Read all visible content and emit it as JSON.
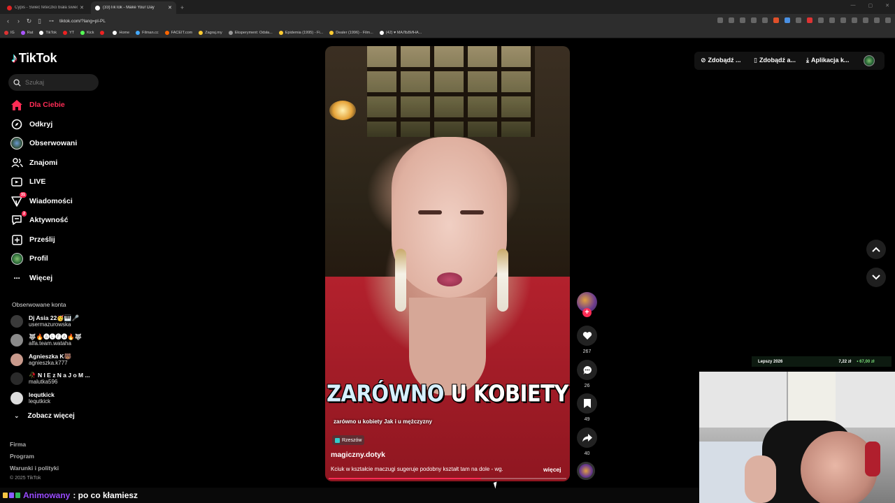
{
  "browser": {
    "tabs": [
      {
        "title": "Cypis - Świeć feteczko biała świeć - ...",
        "active": false,
        "color": "#e02424"
      },
      {
        "title": "(33)TikTok - Make Your Day",
        "active": true,
        "color": "#ffffff"
      }
    ],
    "url": "tiktok.com/?lang=pl-PL",
    "bookmarks": [
      "IG",
      "Rat",
      "TikTok",
      "YT",
      "Kick",
      "",
      "Home",
      "Filman.cc",
      "FACEIT.com",
      "Zagraj.my",
      "Eksperyment: Odsła...",
      "Epidemia (1995) - Fi...",
      "Dealer (1996) - Film...",
      "(42) ♥ МАЛЬВИНА..."
    ]
  },
  "tiktok": {
    "logo_text": "TikTok",
    "search_placeholder": "Szukaj",
    "nav": [
      {
        "label": "Dla Ciebie",
        "icon": "home-icon",
        "active": true
      },
      {
        "label": "Odkryj",
        "icon": "compass-icon"
      },
      {
        "label": "Obserwowani",
        "icon": "following-avatar-icon"
      },
      {
        "label": "Znajomi",
        "icon": "friends-icon"
      },
      {
        "label": "LIVE",
        "icon": "live-icon"
      },
      {
        "label": "Wiadomości",
        "icon": "messages-icon",
        "badge": "31"
      },
      {
        "label": "Aktywność",
        "icon": "activity-icon",
        "badge": "2"
      },
      {
        "label": "Prześlij",
        "icon": "upload-icon"
      },
      {
        "label": "Profil",
        "icon": "profile-avatar-icon"
      },
      {
        "label": "Więcej",
        "icon": "more-icon"
      }
    ],
    "followed_header": "Obserwowane konta",
    "followed": [
      {
        "name": "Dj Asia 22🥳🎹🎤",
        "user": "usermazurowska",
        "color": "#3a3a3a"
      },
      {
        "name": "🐺🔥🅐🅛🅕🅐🔥🐺",
        "user": "alfa.team.wataha",
        "color": "#8a8a8a"
      },
      {
        "name": "Agnieszka K🐻",
        "user": "agnieszka.k777",
        "color": "#c99a8c"
      },
      {
        "name": "🥀 N I E z N a J o M ...",
        "user": "malutka596",
        "color": "#2a2a2a"
      },
      {
        "name": "lequtkick",
        "user": "lequtkick",
        "color": "#dddddd"
      }
    ],
    "see_more": "Zobacz więcej",
    "footer": [
      "Firma",
      "Program",
      "Warunki i polityki"
    ],
    "copyright": "© 2025 TikTok",
    "top_actions": [
      "Zdobądź ...",
      "Zdobądź a...",
      "Aplikacja k..."
    ]
  },
  "video": {
    "caption_word1": "ZARÓWNO",
    "caption_word2": "U KOBIETY",
    "subtitle": "zarówno u kobiety Jak i u mężczyzny",
    "location": "Rzeszów",
    "author": "magiczny.dotyk",
    "description": "Kciuk w kształcie maczugi sugeruje podobny kształt tam na dole - wg.",
    "more": "więcej",
    "progress": 0.64,
    "likes": "267",
    "comments": "26",
    "saves": "49",
    "shares": "40"
  },
  "stream": {
    "bar_title": "Lepszy 2026",
    "bar_value1": "7,22 zł",
    "bar_value2": "• 67,00 zł",
    "chat_user": "Animowany",
    "chat_message": ": po co kłamiesz"
  },
  "colors": {
    "accent": "#fe2c55",
    "bg": "#000000"
  }
}
